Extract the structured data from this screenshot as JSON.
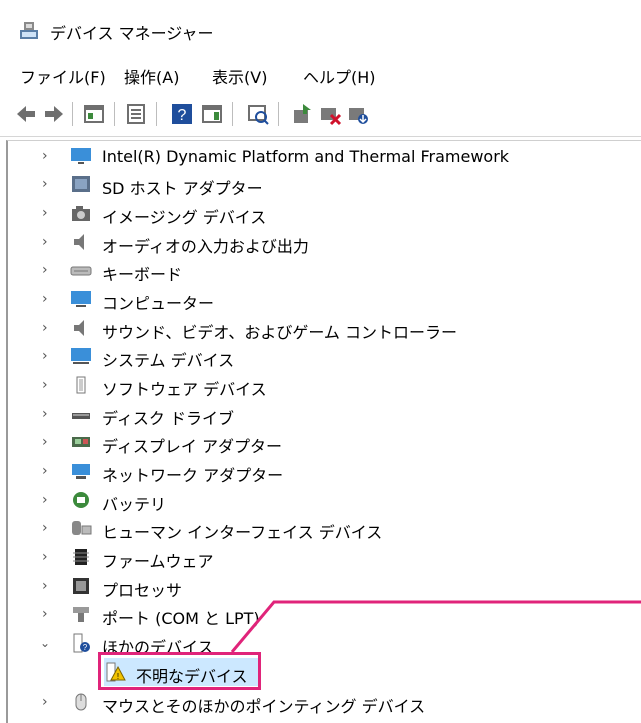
{
  "window": {
    "title": "デバイス マネージャー",
    "icon": "device-manager-icon"
  },
  "menubar": {
    "items": [
      "ファイル(F)",
      "操作(A)",
      "表示(V)",
      "ヘルプ(H)"
    ]
  },
  "toolbar": {
    "buttons": [
      "back-arrow-icon",
      "forward-arrow-icon",
      "properties-grid-icon",
      "console-tree-icon",
      "help-icon",
      "action-pane-icon",
      "scan-hardware-icon",
      "update-driver-icon",
      "disable-device-icon",
      "uninstall-device-icon"
    ]
  },
  "tree": {
    "items": [
      {
        "label": "Intel(R) Dynamic Platform and Thermal Framework",
        "icon": "monitor-icon",
        "expanded": false
      },
      {
        "label": "SD ホスト アダプター",
        "icon": "sd-host-adapter-icon",
        "expanded": false
      },
      {
        "label": "イメージング デバイス",
        "icon": "camera-icon",
        "expanded": false
      },
      {
        "label": "オーディオの入力および出力",
        "icon": "speaker-icon",
        "expanded": false
      },
      {
        "label": "キーボード",
        "icon": "keyboard-icon",
        "expanded": false
      },
      {
        "label": "コンピューター",
        "icon": "computer-icon",
        "expanded": false
      },
      {
        "label": "サウンド、ビデオ、およびゲーム コントローラー",
        "icon": "speaker-icon",
        "expanded": false
      },
      {
        "label": "システム デバイス",
        "icon": "system-device-icon",
        "expanded": false
      },
      {
        "label": "ソフトウェア デバイス",
        "icon": "software-device-icon",
        "expanded": false
      },
      {
        "label": "ディスク ドライブ",
        "icon": "disk-drive-icon",
        "expanded": false
      },
      {
        "label": "ディスプレイ アダプター",
        "icon": "display-adapter-icon",
        "expanded": false
      },
      {
        "label": "ネットワーク アダプター",
        "icon": "network-adapter-icon",
        "expanded": false
      },
      {
        "label": "バッテリ",
        "icon": "battery-icon",
        "expanded": false
      },
      {
        "label": "ヒューマン インターフェイス デバイス",
        "icon": "hid-icon",
        "expanded": false
      },
      {
        "label": "ファームウェア",
        "icon": "firmware-icon",
        "expanded": false
      },
      {
        "label": "プロセッサ",
        "icon": "processor-icon",
        "expanded": false
      },
      {
        "label": "ポート (COM と LPT)",
        "icon": "port-icon",
        "expanded": false
      },
      {
        "label": "ほかのデバイス",
        "icon": "other-devices-icon",
        "expanded": true
      },
      {
        "label": "不明なデバイス",
        "icon": "unknown-device-warning-icon",
        "child": true
      },
      {
        "label": "マウスとそのほかのポインティング デバイス",
        "icon": "mouse-icon",
        "expanded": false
      }
    ]
  },
  "colors": {
    "highlight": "#e0247a",
    "selection": "#cce8ff"
  }
}
